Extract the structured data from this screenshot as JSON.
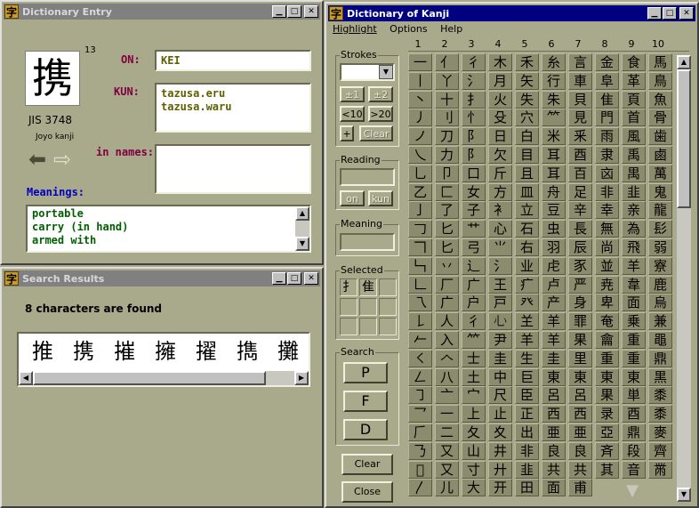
{
  "dictionary_entry": {
    "title": "Dictionary Entry",
    "kanji": "携",
    "stroke_count": "13",
    "jis": "JIS 3748",
    "grade": "Joyo kanji",
    "on_label": "ON:",
    "on_value": "KEI",
    "kun_label": "KUN:",
    "kun_values": [
      "tazusa.eru",
      "tazusa.waru"
    ],
    "names_label": "in names:",
    "names_value": "",
    "meanings_label": "Meanings:",
    "meanings": [
      "portable",
      "carry (in hand)",
      "armed with"
    ]
  },
  "search_results": {
    "title": "Search Results",
    "status": "8 characters are found",
    "results": [
      "推",
      "携",
      "摧",
      "擁",
      "擢",
      "擕",
      "攤"
    ]
  },
  "kanji_dictionary": {
    "title": "Dictionary of Kanji",
    "menu": [
      "Highlight",
      "Options",
      "Help"
    ],
    "strokes_group": "Strokes",
    "strokes_value": "",
    "btn_pm1": "±1",
    "btn_pm2": "±2",
    "btn_lt10": "<10",
    "btn_gt20": ">20",
    "btn_plus": "+",
    "btn_clear_small": "Clear",
    "reading_group": "Reading",
    "reading_value": "",
    "btn_on": "on",
    "btn_kun": "kun",
    "meaning_group": "Meaning",
    "meaning_value": "",
    "selected_group": "Selected",
    "selected": [
      "扌",
      "隹",
      "",
      "",
      "",
      "",
      "",
      "",
      ""
    ],
    "search_group": "Search",
    "search_p": "P",
    "search_f": "F",
    "search_d": "D",
    "btn_clear": "Clear",
    "btn_close": "Close",
    "column_headers": [
      "1",
      "2",
      "3",
      "4",
      "5",
      "6",
      "7",
      "8",
      "9",
      "10"
    ],
    "radicals": [
      [
        "一",
        "亻",
        "彳",
        "木",
        "禾",
        "糸",
        "言",
        "金",
        "食",
        "馬"
      ],
      [
        "丨",
        "丫",
        "⺡",
        "月",
        "矢",
        "行",
        "車",
        "阜",
        "革",
        "鳥"
      ],
      [
        "丶",
        "十",
        "⺘",
        "火",
        "失",
        "朱",
        "貝",
        "隹",
        "頁",
        "魚"
      ],
      [
        "丿",
        "刂",
        "忄",
        "殳",
        "穴",
        "⺮",
        "見",
        "門",
        "首",
        "骨"
      ],
      [
        "ノ",
        "刀",
        "阝",
        "日",
        "白",
        "米",
        "釆",
        "雨",
        "風",
        "歯"
      ],
      [
        "乀",
        "力",
        "阝",
        "欠",
        "目",
        "耳",
        "酉",
        "隶",
        "禹",
        "鹵"
      ],
      [
        "乚",
        "卩",
        "口",
        "斤",
        "且",
        "耳",
        "百",
        "㐫",
        "禺",
        "萬"
      ],
      [
        "乙",
        "匚",
        "女",
        "方",
        "皿",
        "舟",
        "足",
        "非",
        "韭",
        "鬼"
      ],
      [
        "亅",
        "了",
        "子",
        "衤",
        "立",
        "豆",
        "辛",
        "幸",
        "亲",
        "龍"
      ],
      [
        "𠃌",
        "匕",
        "艹",
        "心",
        "石",
        "虫",
        "長",
        "無",
        "為",
        "髟"
      ],
      [
        "𠃍",
        "匕",
        "弓",
        "⺌",
        "右",
        "羽",
        "辰",
        "尚",
        "飛",
        "弱"
      ],
      [
        "𠃑",
        "丷",
        "辶",
        "氵",
        "业",
        "虍",
        "豕",
        "並",
        "羊",
        "寮"
      ],
      [
        "𠃊",
        "厂",
        "广",
        "王",
        "疒",
        "卢",
        "严",
        "尭",
        "韋",
        "鹿"
      ],
      [
        "乁",
        "广",
        "户",
        "戸",
        "癶",
        "产",
        "身",
        "卑",
        "面",
        "烏"
      ],
      [
        "𠄌",
        "人",
        "彳",
        "𢖩",
        "𦍌",
        "羊",
        "罪",
        "奄",
        "乗",
        "兼"
      ],
      [
        "𠂉",
        "入",
        "⺮",
        "尹",
        "羊",
        "羊",
        "果",
        "龠",
        "重",
        "黽"
      ],
      [
        "㇛",
        "𠆢",
        "士",
        "圭",
        "生",
        "圭",
        "里",
        "重",
        "重",
        "鼎"
      ],
      [
        "𠃋",
        "八",
        "土",
        "中",
        "巨",
        "東",
        "東",
        "東",
        "東",
        "黒"
      ],
      [
        "㇆",
        "亠",
        "宀",
        "尺",
        "臣",
        "呂",
        "呂",
        "果",
        "単",
        "黍"
      ],
      [
        "乛",
        "一",
        "上",
        "止",
        "正",
        "西",
        "西",
        "录",
        "酉",
        "黍"
      ],
      [
        "𠂆",
        "二",
        "夂",
        "夊",
        "出",
        "亜",
        "亜",
        "亞",
        "鼎",
        "麥"
      ],
      [
        "𠄎",
        "又",
        "山",
        "井",
        "非",
        "良",
        "良",
        "斉",
        "段",
        "齊"
      ],
      [
        "𠃎",
        "又",
        "寸",
        "廾",
        "韭",
        "共",
        "共",
        "其",
        "音",
        "黹"
      ],
      [
        "〳",
        "儿",
        "大",
        "开",
        "田",
        "面",
        "甫",
        "",
        "",
        ""
      ]
    ]
  }
}
